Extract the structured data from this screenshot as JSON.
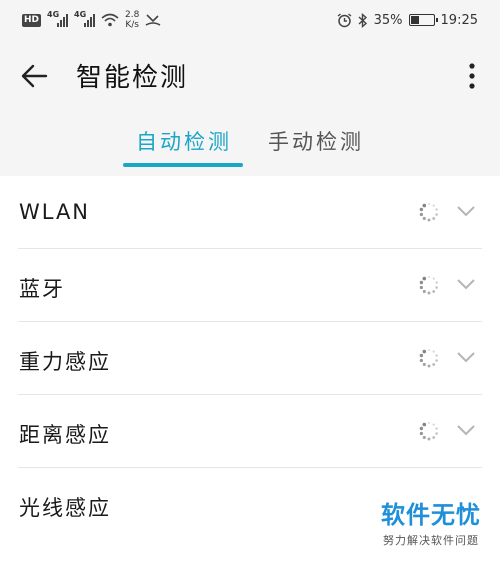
{
  "status_bar": {
    "hd": "HD",
    "net1": "4G",
    "net2": "4G",
    "speed_value": "2.8",
    "speed_unit": "K/s",
    "battery": "35%",
    "time": "19:25"
  },
  "header": {
    "title": "智能检测"
  },
  "tabs": [
    {
      "label": "自动检测",
      "active": true
    },
    {
      "label": "手动检测",
      "active": false
    }
  ],
  "items": [
    {
      "label": "WLAN"
    },
    {
      "label": "蓝牙"
    },
    {
      "label": "重力感应"
    },
    {
      "label": "距离感应"
    },
    {
      "label": "光线感应"
    }
  ],
  "watermark": {
    "logo": "软件无忧",
    "sub": "努力解决软件问题"
  },
  "colors": {
    "accent": "#1aa6c6",
    "background": "#f5f5f5",
    "list_background": "#ffffff"
  }
}
